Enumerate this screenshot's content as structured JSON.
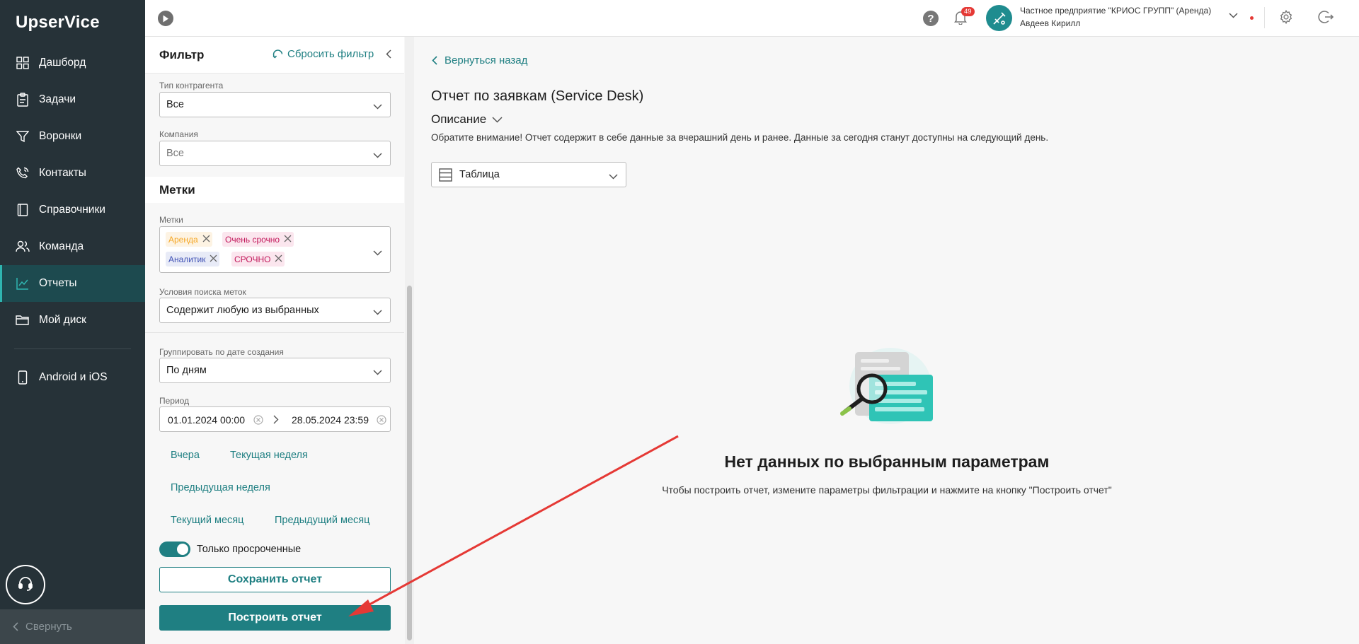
{
  "app": {
    "logo": "UpserVice"
  },
  "sidebar": {
    "items": [
      {
        "label": "Дашборд",
        "icon": "dashboard-icon"
      },
      {
        "label": "Задачи",
        "icon": "tasks-icon"
      },
      {
        "label": "Воронки",
        "icon": "funnel-icon"
      },
      {
        "label": "Контакты",
        "icon": "contacts-icon"
      },
      {
        "label": "Справочники",
        "icon": "book-icon"
      },
      {
        "label": "Команда",
        "icon": "team-icon"
      },
      {
        "label": "Отчеты",
        "icon": "reports-icon",
        "active": true
      },
      {
        "label": "Мой диск",
        "icon": "folder-icon"
      }
    ],
    "mobile": "Android и iOS",
    "collapse": "Свернуть"
  },
  "header": {
    "notifications": "49",
    "company": "Частное предприятие \"КРИОС ГРУПП\" (Аренда)",
    "user": "Авдеев Кирилл"
  },
  "filter": {
    "title": "Фильтр",
    "reset": "Сбросить фильтр",
    "contractor_type": {
      "label": "Тип контрагента",
      "value": "Все"
    },
    "company": {
      "label": "Компания",
      "value": "Все"
    },
    "tags_section": "Метки",
    "tags": {
      "label": "Метки",
      "items": [
        {
          "text": "Аренда",
          "color": "#f5a623"
        },
        {
          "text": "Очень срочно",
          "color": "#c2185b"
        },
        {
          "text": "Аналитик",
          "color": "#3f51b5"
        },
        {
          "text": "СРОЧНО",
          "color": "#c2185b"
        }
      ]
    },
    "tag_condition": {
      "label": "Условия поиска меток",
      "value": "Содержит любую из выбранных"
    },
    "group_by": {
      "label": "Группировать по дате создания",
      "value": "По дням"
    },
    "period": {
      "label": "Период",
      "from": "01.01.2024 00:00",
      "to": "28.05.2024 23:59"
    },
    "quick": {
      "yesterday": "Вчера",
      "current_week": "Текущая неделя",
      "previous_week": "Предыдущая неделя",
      "current_month": "Текущий месяц",
      "previous_month": "Предыдущий месяц"
    },
    "overdue_only": "Только просроченные",
    "save": "Сохранить отчет",
    "build": "Построить отчет"
  },
  "main": {
    "back": "Вернуться назад",
    "title": "Отчет по заявкам (Service Desk)",
    "description": "Описание",
    "notice": "Обратите внимание! Отчет содержит в себе данные за вчерашний день и ранее. Данные за сегодня станут доступны на следующий день.",
    "view": "Таблица",
    "empty_title": "Нет данных по выбранным параметрам",
    "empty_sub": "Чтобы построить отчет, измените параметры фильтрации и нажмите на кнопку \"Построить отчет\""
  },
  "colors": {
    "sidebar": "#263238",
    "accent": "#1f7f82",
    "arrow": "#e53935"
  }
}
